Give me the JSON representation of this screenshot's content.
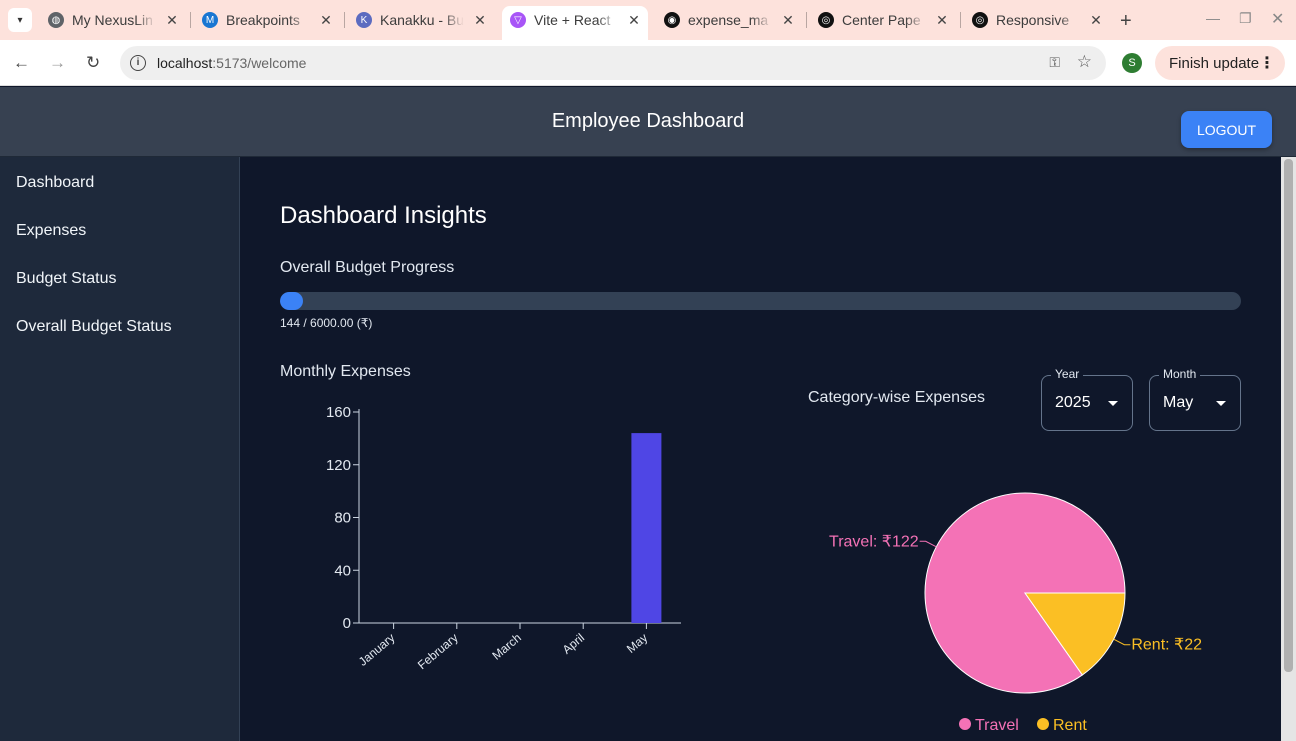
{
  "browser": {
    "tabs": [
      {
        "title": "My NexusLin",
        "color": "#5f6368",
        "glyph": "◍"
      },
      {
        "title": "Breakpoints",
        "color": "#1976d2",
        "glyph": "M"
      },
      {
        "title": "Kanakku - Bu",
        "color": "#5c6bc0",
        "glyph": "K"
      },
      {
        "title": "Vite + React",
        "color": "#a855f7",
        "glyph": "▽"
      },
      {
        "title": "expense_ma",
        "color": "#111111",
        "glyph": "◉"
      },
      {
        "title": "Center Pape",
        "color": "#111111",
        "glyph": "◎"
      },
      {
        "title": "Responsive",
        "color": "#111111",
        "glyph": "◎"
      }
    ],
    "url_host": "localhost",
    "url_path": ":5173/welcome",
    "profile_initial": "S",
    "finish_update": "Finish update"
  },
  "app": {
    "title": "Employee Dashboard",
    "logout": "LOGOUT"
  },
  "sidebar": {
    "items": [
      {
        "label": "Dashboard"
      },
      {
        "label": "Expenses"
      },
      {
        "label": "Budget Status"
      },
      {
        "label": "Overall Budget Status"
      }
    ]
  },
  "main": {
    "heading": "Dashboard Insights",
    "budget_heading": "Overall Budget Progress",
    "budget_text": "144 / 6000.00 (₹)",
    "budget_fraction": 0.024,
    "monthly_heading": "Monthly Expenses",
    "category_heading": "Category-wise Expenses",
    "year": {
      "label": "Year",
      "value": "2025"
    },
    "month": {
      "label": "Month",
      "value": "May"
    }
  },
  "chart_data": [
    {
      "type": "bar",
      "categories": [
        "January",
        "February",
        "March",
        "April",
        "May"
      ],
      "values": [
        0,
        0,
        0,
        0,
        144
      ],
      "ylim": [
        0,
        160
      ],
      "yticks": [
        0,
        40,
        80,
        120,
        160
      ],
      "color": "#4f46e5"
    },
    {
      "type": "pie",
      "labels": [
        "Travel",
        "Rent"
      ],
      "values": [
        122,
        22
      ],
      "slice_labels": [
        "Travel: ₹122",
        "Rent: ₹22"
      ],
      "colors": [
        "#f472b6",
        "#fbbf24"
      ],
      "legend": "bottom"
    }
  ]
}
